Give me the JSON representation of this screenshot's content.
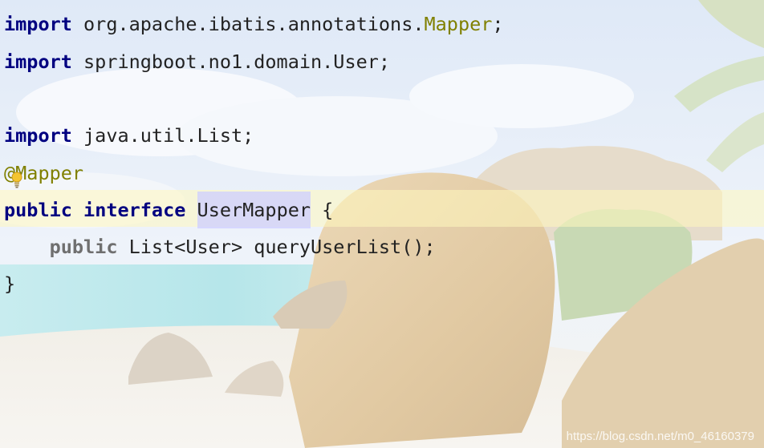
{
  "code": {
    "line1": {
      "keyword": "import",
      "path": " org.apache.ibatis.annotations.",
      "annotation_name": "Mapper",
      "end": ";"
    },
    "line2": {
      "keyword": "import",
      "path": " springboot.no1.domain.User;"
    },
    "line3": {
      "keyword": "import",
      "path": " java.util.List;"
    },
    "line4": {
      "at": "@",
      "name": "Mapper"
    },
    "line5": {
      "kw1": "public",
      "kw2": "interface",
      "class_name": "UserMapper",
      "brace": " {"
    },
    "line6": {
      "kw": "public",
      "signature": " List<User> queryUserList();"
    },
    "line7": {
      "brace": "}"
    }
  },
  "watermark": "https://blog.csdn.net/m0_46160379",
  "colors": {
    "keyword": "#000080",
    "annotation": "#808000",
    "caret_row": "#fff8be",
    "identifier_highlight": "#cdcdff"
  },
  "icons": [
    "intention-bulb-icon"
  ]
}
